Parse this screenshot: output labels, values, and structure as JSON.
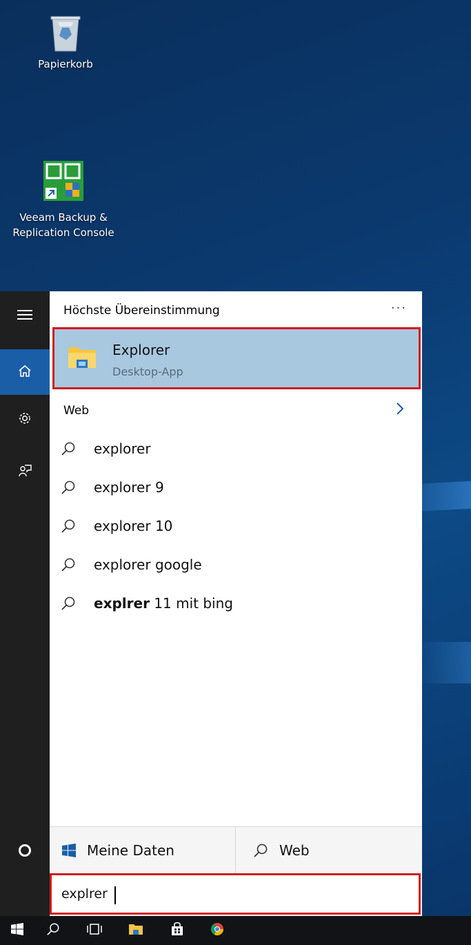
{
  "desktop": {
    "icons": [
      {
        "label": "Papierkorb",
        "icon": "recycle-bin-icon"
      },
      {
        "label": "Veeam Backup & Replication Console",
        "icon": "veeam-icon"
      }
    ]
  },
  "start_menu": {
    "rail": {
      "items": [
        {
          "name": "hamburger-menu-icon"
        },
        {
          "name": "home-icon",
          "active": true
        },
        {
          "name": "settings-icon"
        },
        {
          "name": "feedback-icon"
        },
        {
          "name": "cortana-icon"
        }
      ]
    },
    "best_match": {
      "heading": "Höchste Übereinstimmung",
      "more": "···",
      "name": "Explorer",
      "subtitle": "Desktop-App"
    },
    "web": {
      "heading": "Web",
      "suggestions": [
        {
          "bold": "",
          "text": "explorer"
        },
        {
          "bold": "",
          "text": "explorer 9"
        },
        {
          "bold": "",
          "text": "explorer 10"
        },
        {
          "bold": "",
          "text": "explorer google"
        },
        {
          "bold": "explrer",
          "text": " 11 mit bing"
        }
      ]
    },
    "bottom": {
      "my_stuff": "Meine Daten",
      "web": "Web"
    },
    "search": {
      "value": "explrer"
    }
  },
  "taskbar": {
    "items": [
      "start-button-icon",
      "search-icon",
      "task-view-icon",
      "file-explorer-icon",
      "store-icon",
      "chrome-icon"
    ]
  },
  "colors": {
    "highlight": "#a8c8e0",
    "accent": "#1a5ea8",
    "annotation_red": "#d11a1a"
  }
}
